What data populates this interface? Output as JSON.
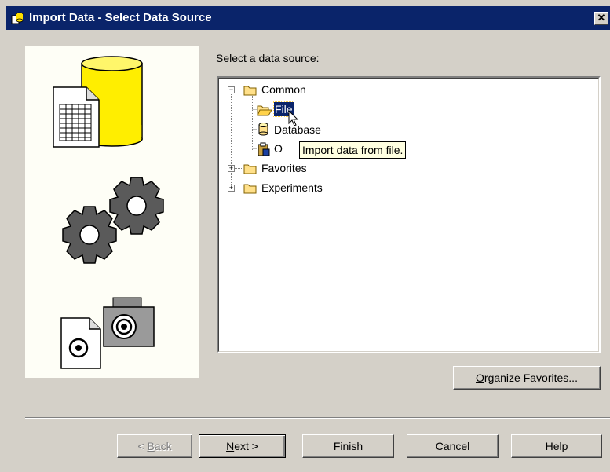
{
  "window": {
    "title": "Import Data - Select Data Source",
    "close_glyph": "✕"
  },
  "source_label": "Select a data source:",
  "tree": {
    "common": {
      "label": "Common",
      "expander": "−"
    },
    "file": {
      "label": "File"
    },
    "database": {
      "label": "Database",
      "clipped_prefix": "Da"
    },
    "other": {
      "label": "O"
    },
    "favorites": {
      "label": "Favorites",
      "expander": "+"
    },
    "experiments": {
      "label": "Experiments",
      "expander": "+"
    }
  },
  "tooltip": "Import data from file.",
  "buttons": {
    "organize": {
      "label": "Organize Favorites...",
      "mnemonic": "O",
      "rest": "rganize Favorites..."
    },
    "back": {
      "label": "< Back",
      "pre": "< ",
      "mnemonic": "B",
      "rest": "ack"
    },
    "next": {
      "label": "Next >",
      "mnemonic": "N",
      "rest": "ext >"
    },
    "finish": {
      "label": "Finish"
    },
    "cancel": {
      "label": "Cancel"
    },
    "help": {
      "label": "Help"
    }
  },
  "colors": {
    "titlebar": "#0a246a",
    "dialog_bg": "#d4d0c8",
    "folder": "#ffe08a",
    "tooltip_bg": "#ffffe1"
  }
}
